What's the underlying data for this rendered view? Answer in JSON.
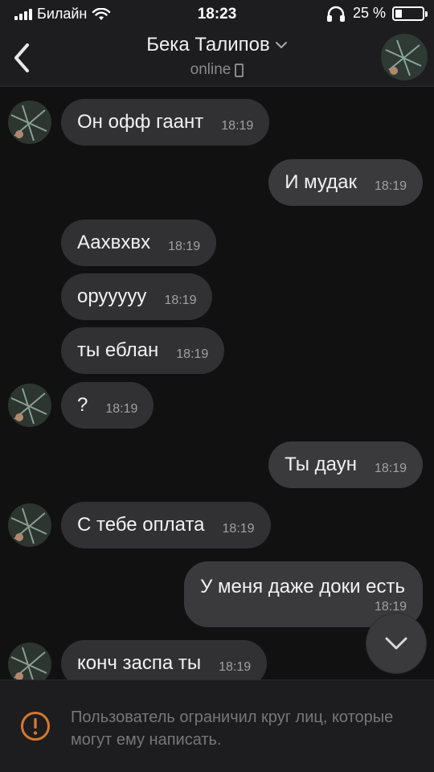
{
  "status_bar": {
    "carrier": "Билайн",
    "time": "18:23",
    "battery": "25 %"
  },
  "header": {
    "contact_name": "Бека Талипов",
    "presence": "online"
  },
  "messages": [
    {
      "dir": "in",
      "text": "Он офф гаант",
      "time": "18:19"
    },
    {
      "dir": "out",
      "text": "И мудак",
      "time": "18:19"
    },
    {
      "dir": "in",
      "text": "Аахвхвх",
      "time": "18:19"
    },
    {
      "dir": "in",
      "text": "оруууyy",
      "time": "18:19"
    },
    {
      "dir": "in",
      "text": "ты еблан",
      "time": "18:19"
    },
    {
      "dir": "in",
      "text": "?",
      "time": "18:19"
    },
    {
      "dir": "out",
      "text": "Ты даун",
      "time": "18:19"
    },
    {
      "dir": "in",
      "text": "С тебе оплата",
      "time": "18:19"
    },
    {
      "dir": "out",
      "text": "У меня даже доки есть",
      "time": "18:19"
    },
    {
      "dir": "in",
      "text": "конч заспа ты",
      "time": "18:19"
    }
  ],
  "footer": {
    "restriction_notice": "Пользователь ограничил круг лиц, которые могут ему написать."
  },
  "colors": {
    "accent_warning": "#d9772b",
    "bubble": "#313133",
    "background": "#111112"
  },
  "icons": {
    "back": "chevron-left-icon",
    "dropdown": "chevron-down-icon",
    "scroll": "chevron-down-icon",
    "warning": "warning-circle-icon"
  }
}
